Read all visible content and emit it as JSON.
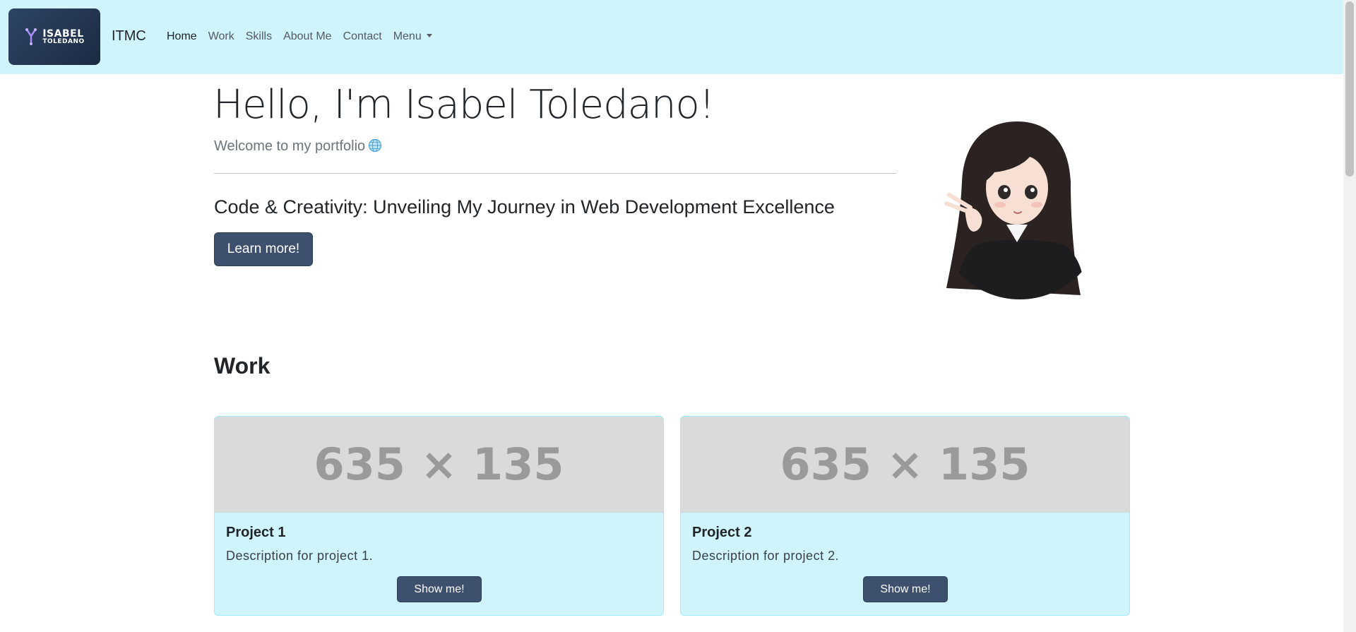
{
  "nav": {
    "logo_line1": "ISABEL",
    "logo_line2": "TOLEDANO",
    "brand": "ITMC",
    "links": [
      {
        "label": "Home",
        "active": true
      },
      {
        "label": "Work"
      },
      {
        "label": "Skills"
      },
      {
        "label": "About Me"
      },
      {
        "label": "Contact"
      },
      {
        "label": "Menu",
        "dropdown": true
      }
    ]
  },
  "hero": {
    "title": "Hello, I'm Isabel Toledano!",
    "subtitle": "Welcome to my portfolio",
    "subtitle_icon": "globe-icon",
    "tagline": "Code & Creativity: Unveiling My Journey in Web Development Excellence",
    "button": "Learn more!"
  },
  "work": {
    "heading": "Work",
    "projects": [
      {
        "placeholder": "635 × 135",
        "title": "Project 1",
        "description": "Description for project 1.",
        "button": "Show me!"
      },
      {
        "placeholder": "635 × 135",
        "title": "Project 2",
        "description": "Description for project 2.",
        "button": "Show me!"
      }
    ]
  },
  "colors": {
    "navbar_bg": "#cff4fc",
    "button_bg": "#3d516e",
    "card_bg": "#cff4fc",
    "placeholder_bg": "#dadada"
  }
}
